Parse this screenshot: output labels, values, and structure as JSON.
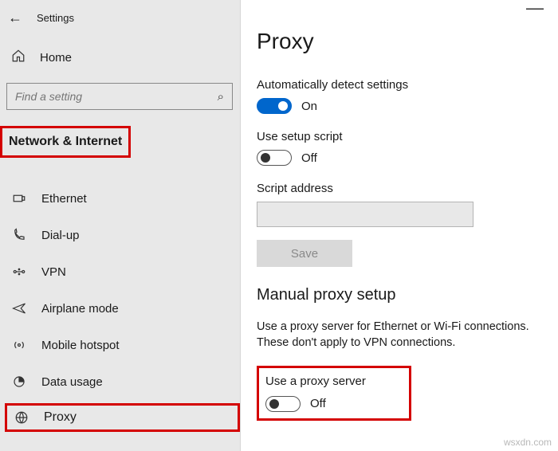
{
  "titlebar": {
    "title": "Settings"
  },
  "home": {
    "label": "Home"
  },
  "search": {
    "placeholder": "Find a setting"
  },
  "section": {
    "header": "Network & Internet"
  },
  "nav": {
    "items": [
      {
        "label": "Ethernet"
      },
      {
        "label": "Dial-up"
      },
      {
        "label": "VPN"
      },
      {
        "label": "Airplane mode"
      },
      {
        "label": "Mobile hotspot"
      },
      {
        "label": "Data usage"
      },
      {
        "label": "Proxy"
      }
    ]
  },
  "page": {
    "heading": "Proxy",
    "auto": {
      "detect_label": "Automatically detect settings",
      "detect_state": "On",
      "script_label": "Use setup script",
      "script_state": "Off",
      "address_label": "Script address",
      "save_label": "Save"
    },
    "manual": {
      "heading": "Manual proxy setup",
      "desc": "Use a proxy server for Ethernet or Wi-Fi connections. These don't apply to VPN connections.",
      "use_label": "Use a proxy server",
      "use_state": "Off"
    }
  },
  "watermark": "wsxdn.com"
}
